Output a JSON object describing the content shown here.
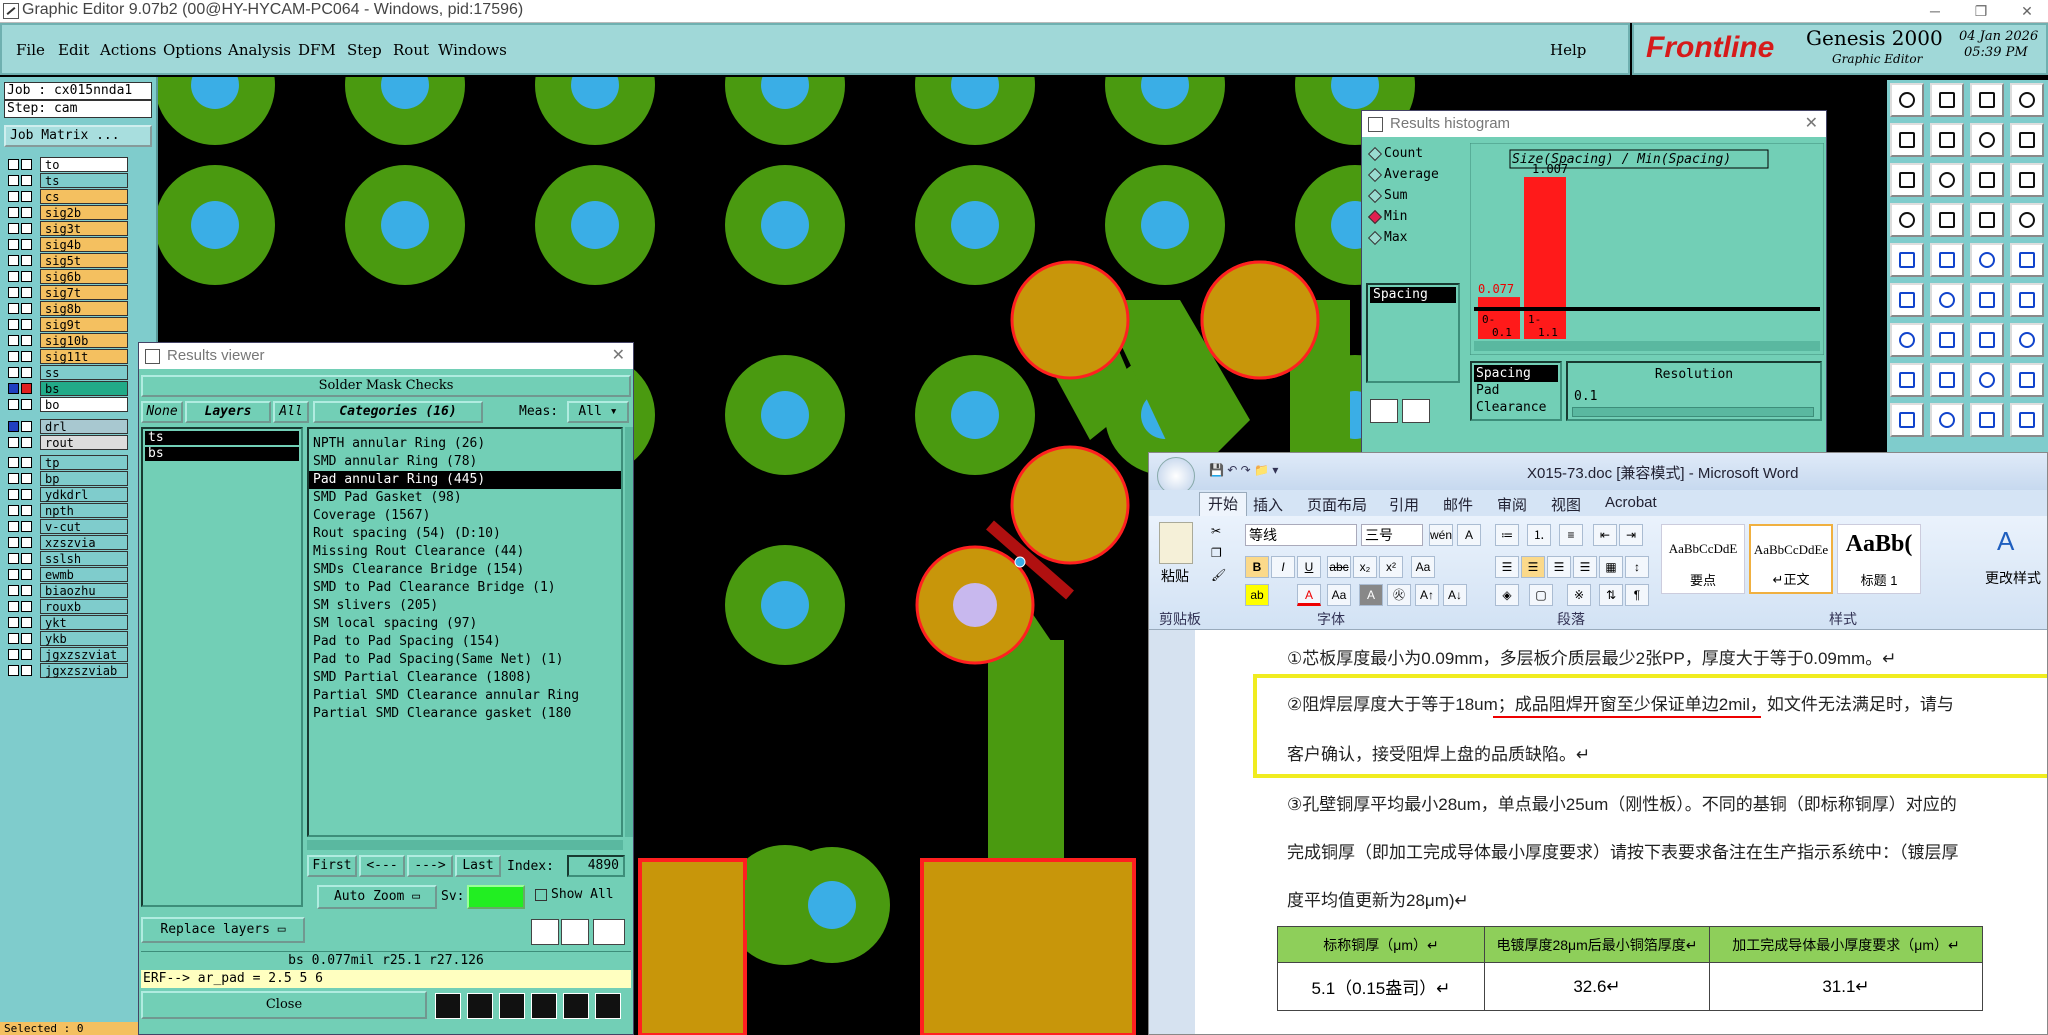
{
  "title_bar": {
    "text": "Graphic Editor 9.07b2 (00@HY-HYCAM-PC064 - Windows, pid:17596)"
  },
  "menu": {
    "items": [
      "File",
      "Edit",
      "Actions",
      "Options",
      "Analysis",
      "DFM",
      "Step",
      "Rout",
      "Windows"
    ],
    "help": "Help"
  },
  "logo": {
    "brand": "Frontline",
    "product": "Genesis 2000",
    "sub": "Graphic Editor",
    "date": "04 Jan 2026",
    "time": "05:39 PM"
  },
  "left": {
    "job": "Job : cx015nnda1",
    "step": "Step: cam",
    "job_matrix": "Job Matrix ...",
    "layers_a": [
      {
        "name": "to",
        "color": "#ffffff"
      },
      {
        "name": "ts",
        "color": "#7fcccc"
      },
      {
        "name": "cs",
        "color": "#f4c060"
      },
      {
        "name": "sig2b",
        "color": "#f4c060"
      },
      {
        "name": "sig3t",
        "color": "#f4c060"
      },
      {
        "name": "sig4b",
        "color": "#f4c060"
      },
      {
        "name": "sig5t",
        "color": "#f4c060"
      },
      {
        "name": "sig6b",
        "color": "#f4c060"
      },
      {
        "name": "sig7t",
        "color": "#f4c060"
      },
      {
        "name": "sig8b",
        "color": "#f4c060"
      },
      {
        "name": "sig9t",
        "color": "#f4c060"
      },
      {
        "name": "sig10b",
        "color": "#f4c060"
      },
      {
        "name": "sig11t",
        "color": "#f4c060"
      },
      {
        "name": "ss",
        "color": "#7fcccc"
      },
      {
        "name": "bs",
        "color": "#22aa88"
      },
      {
        "name": "bo",
        "color": "#ffffff"
      }
    ],
    "layers_b": [
      {
        "name": "drl",
        "color": "#a8c8d0"
      },
      {
        "name": "rout",
        "color": "#dddddd"
      }
    ],
    "layers_c": [
      "tp",
      "bp",
      "ydkdrl",
      "npth",
      "v-cut",
      "xzszvia",
      "sslsh",
      "ewmb",
      "biaozhu",
      "rouxb",
      "ykt",
      "ykb",
      "jgxzszviat",
      "jgxzszviab"
    ],
    "selected": "Selected : 0"
  },
  "results_viewer": {
    "title": "Results viewer",
    "header": "Solder Mask Checks",
    "none": "None",
    "layers": "Layers",
    "all": "All",
    "categories": "Categories (16)",
    "meas_label": "Meas:",
    "meas_value": "All",
    "layer_items": [
      "ts",
      "bs"
    ],
    "category_items": [
      "NPTH annular Ring (26)",
      "SMD annular Ring (78)",
      "Pad annular Ring (445)",
      "SMD Pad Gasket (98)",
      "Coverage (1567)",
      "Rout spacing (54)        (D:10)",
      "Missing Rout Clearance (44)",
      "SMDs Clearance Bridge (154)",
      "SMD to Pad Clearance Bridge (1)",
      "SM slivers (205)",
      "SM local spacing (97)",
      "Pad to Pad Spacing (154)",
      "Pad to Pad Spacing(Same Net) (1)",
      "SMD Partial Clearance (1808)",
      "Partial SMD Clearance annular Ring",
      "Partial SMD Clearance gasket (180"
    ],
    "selected_index": 2,
    "nav": {
      "first": "First",
      "prev": "<---",
      "next": "--->",
      "last": "Last",
      "index_label": "Index:",
      "index_value": "4890"
    },
    "replace_layers": "Replace layers",
    "auto_zoom": "Auto Zoom",
    "sv": "Sv:",
    "show_all": "Show All",
    "status_line": "bs 0.077mil  r25.1  r27.126",
    "erf_line": "ERF--> ar_pad = 2.5 5 6",
    "close": "Close"
  },
  "histogram": {
    "title": "Results histogram",
    "radios": [
      "Count",
      "Average",
      "Sum",
      "Min",
      "Max"
    ],
    "selected_radio": "Min",
    "list_item": "Spacing",
    "chart_title": "Size(Spacing) / Min(Spacing)",
    "bars": [
      {
        "range_top": "0-",
        "range_bot": "0.1",
        "value": "0.077",
        "level": 0.077
      },
      {
        "range_top": "1-",
        "range_bot": "1.1",
        "value": "1.007",
        "level": 1.007
      }
    ],
    "bottom_list": [
      "Spacing",
      "Pad",
      "Clearance"
    ],
    "resolution_label": "Resolution",
    "resolution_value": "0.1"
  },
  "word": {
    "title": "X015-73.doc [兼容模式] - Microsoft Word",
    "tabs": [
      "开始",
      "插入",
      "页面布局",
      "引用",
      "邮件",
      "审阅",
      "视图",
      "Acrobat"
    ],
    "active_tab": "开始",
    "font_name": "等线",
    "font_size": "三号",
    "paste": "粘贴",
    "groups": {
      "clipboard": "剪贴板",
      "font": "字体",
      "paragraph": "段落",
      "styles": "样式"
    },
    "styles": [
      {
        "preview": "AaBbCcDdE",
        "name": "要点"
      },
      {
        "preview": "AaBbCcDdEe",
        "name": "↵正文"
      },
      {
        "preview": "AaBb(",
        "name": "标题 1"
      }
    ],
    "change_styles": "更改样式",
    "paragraphs": [
      "①芯板厚度最小为0.09mm，多层板介质层最少2张PP，厚度大于等于0.09mm。↵",
      "②阻焊层厚度大于等于18um；成品阻焊开窗至少保证单边2mil，如文件无法满足时，请与",
      "客户确认，接受阻焊上盘的品质缺陷。↵",
      "③孔壁铜厚平均最小28um，单点最小25um（刚性板）。不同的基铜（即标称铜厚）对应的",
      "完成铜厚（即加工完成导体最小厚度要求）请按下表要求备注在生产指示系统中：（镀层厚",
      "度平均值更新为28μm)↵"
    ],
    "table_headers": [
      "标称铜厚（μm）↵",
      "电镀厚度28μm后最小铜箔厚度↵",
      "加工完成导体最小厚度要求（μm）↵"
    ],
    "table_row": [
      "5.1（0.15盎司）↵",
      "32.6↵",
      "31.1↵"
    ]
  },
  "colors": {
    "pad_green": "#4a9a10",
    "pad_blue": "#3aaee6",
    "pad_gold": "#c8960a",
    "highlight_red": "#ff2020",
    "bar_red": "#ff1a1a"
  }
}
